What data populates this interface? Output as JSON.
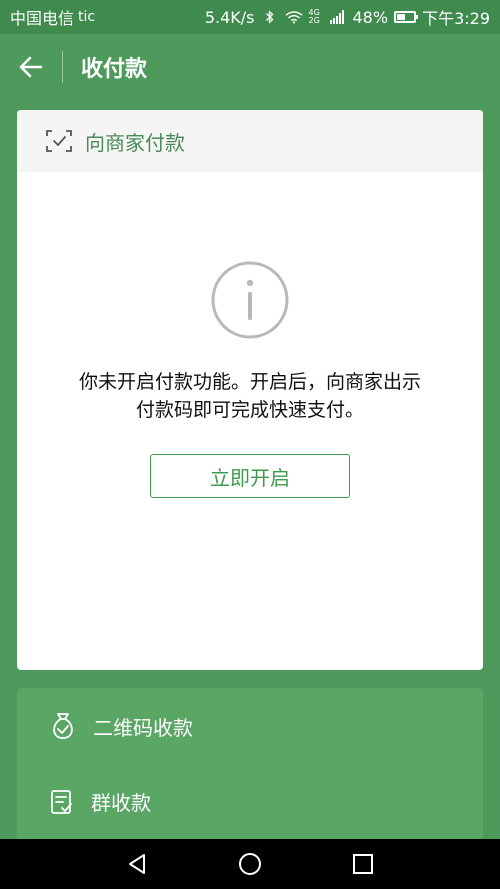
{
  "status_bar": {
    "carrier": "中国电信",
    "carrier_suffix": "tic",
    "net_speed": "5.4K/s",
    "signal_text": "4G 2G",
    "battery": "48%",
    "time": "下午3:29"
  },
  "app_bar": {
    "title": "收付款",
    "back_icon": "arrow-left-icon"
  },
  "card": {
    "header_label": "向商家付款",
    "header_icon": "scan-check-icon",
    "info_icon": "info-circle-icon",
    "message_line1": "你未开启付款功能。开启后，向商家出示",
    "message_line2": "付款码即可完成快速支付。",
    "button_label": "立即开启"
  },
  "list": {
    "items": [
      {
        "label": "二维码收款",
        "icon": "money-bag-icon"
      },
      {
        "label": "群收款",
        "icon": "group-receipt-icon"
      }
    ]
  },
  "nav_bar": {
    "back_icon": "triangle-back-icon",
    "home_icon": "circle-home-icon",
    "recents_icon": "square-recents-icon"
  },
  "colors": {
    "primary_green": "#4e9a5c",
    "accent_green": "#3f9a4e",
    "card_bg": "#ffffff"
  }
}
